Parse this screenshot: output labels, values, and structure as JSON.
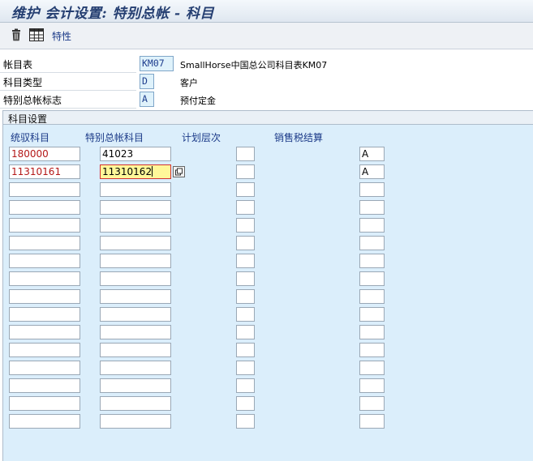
{
  "window": {
    "title": "维护 会计设置: 特别总帐 - 科目"
  },
  "toolbar": {
    "properties_label": "特性"
  },
  "header": [
    {
      "label": "帐目表",
      "value": "KM07",
      "desc": "SmallHorse中国总公司科目表KM07"
    },
    {
      "label": "科目类型",
      "value": "D",
      "desc": "客户"
    },
    {
      "label": "特别总帐标志",
      "value": "A",
      "desc": "预付定金"
    }
  ],
  "account_settings": {
    "title": "科目设置",
    "columns": [
      "统驭科目",
      "特别总帐科目",
      "计划层次",
      "销售税结算"
    ],
    "rows": [
      [
        "180000",
        "41023",
        "",
        "A"
      ],
      [
        "11310161",
        "11310162",
        "",
        "A"
      ],
      [
        "",
        "",
        "",
        ""
      ],
      [
        "",
        "",
        "",
        ""
      ],
      [
        "",
        "",
        "",
        ""
      ],
      [
        "",
        "",
        "",
        ""
      ],
      [
        "",
        "",
        "",
        ""
      ],
      [
        "",
        "",
        "",
        ""
      ],
      [
        "",
        "",
        "",
        ""
      ],
      [
        "",
        "",
        "",
        ""
      ],
      [
        "",
        "",
        "",
        ""
      ],
      [
        "",
        "",
        "",
        ""
      ],
      [
        "",
        "",
        "",
        ""
      ],
      [
        "",
        "",
        "",
        ""
      ],
      [
        "",
        "",
        "",
        ""
      ],
      [
        "",
        "",
        "",
        ""
      ]
    ]
  },
  "icons": {
    "delete": "trash-icon",
    "properties": "table-grid-icon",
    "value_help": "f4-help-icon"
  }
}
